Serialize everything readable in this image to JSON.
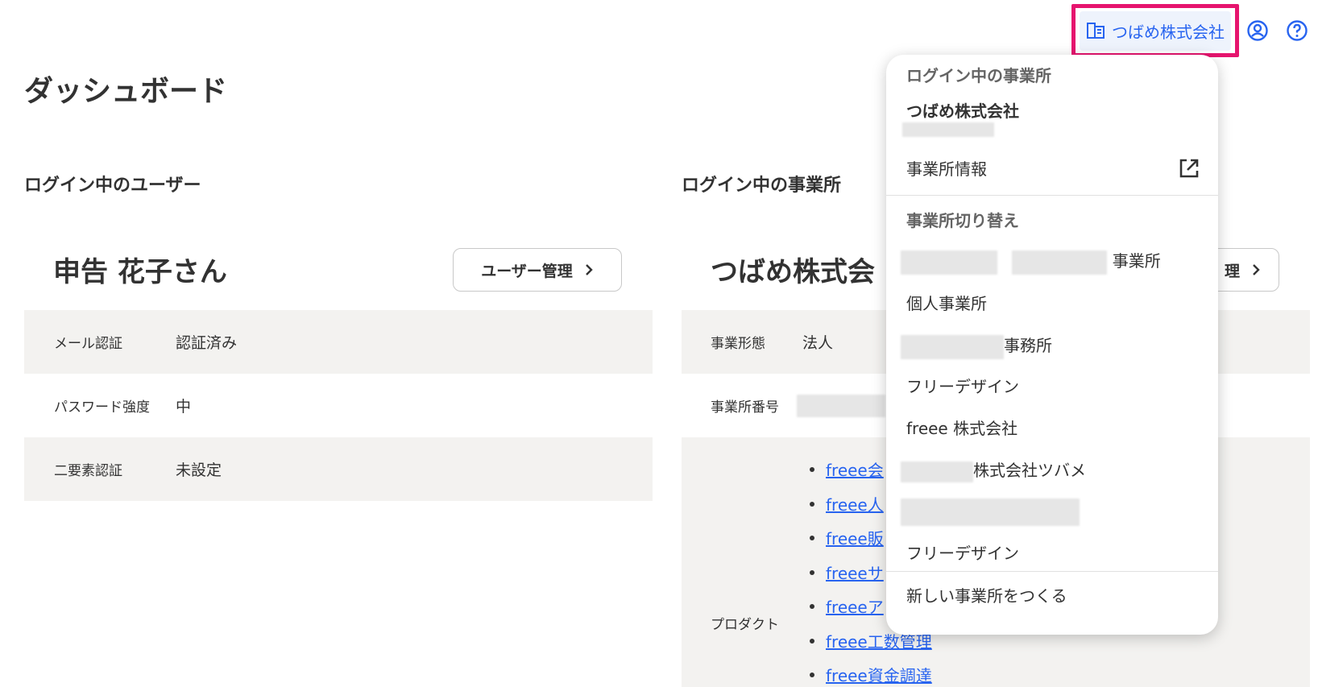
{
  "header": {
    "company_label": "つばめ株式会社",
    "company_icon": "building-icon",
    "account_icon": "account-circle-icon",
    "help_icon": "help-circle-icon",
    "accent_color": "#2864f0",
    "highlight_color": "#e6146e"
  },
  "page": {
    "title": "ダッシュボード"
  },
  "user_section": {
    "title": "ログイン中のユーザー",
    "user_name": "申告 花子さん",
    "manage_button": "ユーザー管理",
    "rows": [
      {
        "key": "メール認証",
        "value": "認証済み"
      },
      {
        "key": "パスワード強度",
        "value": "中"
      },
      {
        "key": "二要素認証",
        "value": "未設定"
      }
    ]
  },
  "office_section": {
    "title": "ログイン中の事業所",
    "company_name": "つばめ株式会",
    "manage_button_partial": "理",
    "rows": [
      {
        "key": "事業形態",
        "value": "法人"
      },
      {
        "key": "事業所番号",
        "value": ""
      },
      {
        "key": "プロダクト",
        "value": ""
      }
    ],
    "products": [
      "freee会",
      "freee人",
      "freee販",
      "freeeサ",
      "freeeア",
      "freee工数管理",
      "freee資金調達"
    ]
  },
  "dropdown": {
    "heading": "ログイン中の事業所",
    "current_company": "つばめ株式会社",
    "office_info": "事業所情報",
    "external_icon": "external-link-icon",
    "switch_heading": "事業所切り替え",
    "switch_items": [
      "事業所",
      "個人事業所",
      "事務所",
      "フリーデザイン",
      "freee 株式会社",
      "株式会社ツバメ",
      "",
      "フリーデザイン"
    ],
    "create_new": "新しい事業所をつくる"
  }
}
